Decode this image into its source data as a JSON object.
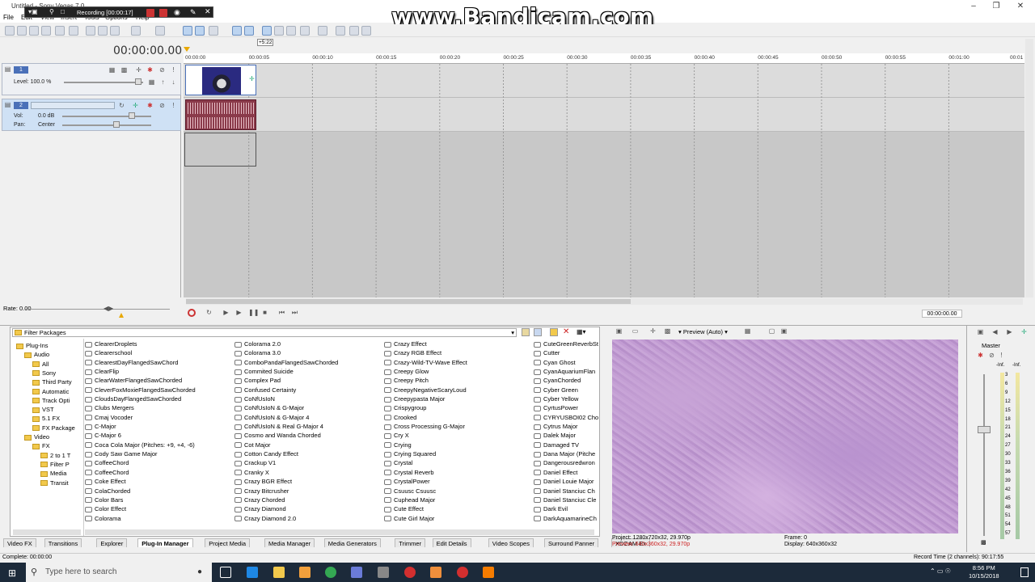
{
  "window": {
    "title": "Untitled - Sony Vegas 7.0"
  },
  "menu": [
    "File",
    "Edit",
    "View",
    "Insert",
    "Tools",
    "Options",
    "Help"
  ],
  "recorder": {
    "label": "Recording [00:00:17]"
  },
  "watermark": "www.Bandicam.com",
  "timecode": "00:00:00.00",
  "cursor_label": "+5:22",
  "ruler_marks": [
    "00:00:00",
    "00:00:05",
    "00:00:10",
    "00:00:15",
    "00:00:20",
    "00:00:25",
    "00:00:30",
    "00:00:35",
    "00:00:40",
    "00:00:45",
    "00:00:50",
    "00:00:55",
    "00:01:00",
    "00:01"
  ],
  "track1": {
    "number": "1",
    "level_label": "Level: 100.0 %"
  },
  "track2": {
    "number": "2",
    "vol_label": "Vol:",
    "vol_value": "0.0 dB",
    "pan_label": "Pan:",
    "pan_value": "Center"
  },
  "rate": "Rate: 0.00",
  "transport_time": "00:00:00.00",
  "plugin_manager": {
    "filter": "Filter Packages",
    "tree": [
      "Plug-Ins",
      "Audio",
      "All",
      "Sony",
      "Third Party",
      "Automatic",
      "Track Opti",
      "VST",
      "5.1 FX",
      "FX Package",
      "Video",
      "FX",
      "2 to 1 T",
      "Filter P",
      "Media",
      "Transit"
    ],
    "col1": [
      "ClearerDroplets",
      "Clearerschool",
      "ClearestDayFlangedSawChord",
      "ClearFlip",
      "ClearWaterFlangedSawChorded",
      "CleverFoxMoxieFlangedSawChorded",
      "CloudsDayFlangedSawChorded",
      "Clubs Mergers",
      "Cmaj Vocoder",
      "C-Major",
      "C-Major 6",
      "Coca Cola Major (Pitches: +9, +4, -6)",
      "Cody Saw Game Major",
      "CoffeeChord",
      "CoffeeChord",
      "Coke Effect",
      "ColaChorded",
      "Color Bars",
      "Color Effect",
      "Colorama"
    ],
    "col2": [
      "Colorama 2.0",
      "Colorama 3.0",
      "ComboPandaFlangedSawChorded",
      "Commited Suicide",
      "Complex Pad",
      "Confused Certainty",
      "CoNfUsIoN",
      "CoNfUsIoN & G-Major",
      "CoNfUsIoN & G-Major 4",
      "CoNfUsIoN & Real G-Major 4",
      "Cosmo and Wanda Chorded",
      "Cot Major",
      "Cotton Candy Effect",
      "Crackup V1",
      "Cranky X",
      "Crazy BGR Effect",
      "Crazy Bitcrusher",
      "Crazy Chorded",
      "Crazy Diamond",
      "Crazy Diamond 2.0"
    ],
    "col3": [
      "Crazy Effect",
      "Crazy RGB Effect",
      "Crazy-Wild-TV-Wave Effect",
      "Creepy Glow",
      "Creepy Pitch",
      "CreepyNegativeScaryLoud",
      "Creepypasta Major",
      "Crispygroup",
      "Crooked",
      "Cross Processing G-Major",
      "Cry X",
      "Crying",
      "Crying Squared",
      "Crystal",
      "Crystal Reverb",
      "CrystalPower",
      "Csuusc Csuusc",
      "Cuphead Major",
      "Cute Effect",
      "Cute Girl Major"
    ],
    "col4": [
      "CuteGreenReverbSt",
      "Cutter",
      "Cyan Ghost",
      "CyanAquariumFlan",
      "CyanChorded",
      "Cyber Green",
      "Cyber Yellow",
      "CyrtusPower",
      "CYRYUSBOI02 Chor",
      "Cytrus Major",
      "Dalek Major",
      "Damaged TV",
      "Dana Major (Pitche",
      "Dangerousredwron",
      "Daniel Effect",
      "Daniel Louie Major",
      "Daniel Stanciuc Ch",
      "Daniel Stanciuc Cle",
      "Dark Evil",
      "DarkAquamarineCh"
    ]
  },
  "tabs": [
    "Video FX",
    "Transitions",
    "Explorer",
    "Plug-In Manager",
    "Project Media",
    "Media Manager",
    "Media Generators",
    "Trimmer",
    "Edit Details",
    "Video Scopes",
    "Surround Panner",
    "XDCAM Ex"
  ],
  "preview": {
    "mode": "Preview (Auto)",
    "project": "Project:  1280x720x32, 29.970p",
    "preview": "Preview:  640x360x32, 29.970p",
    "frame": "Frame:    0",
    "display": "Display:   640x360x32"
  },
  "master": {
    "label": "Master",
    "inf1": "-Inf.",
    "inf2": "-Inf.",
    "scale": [
      "3",
      "6",
      "9",
      "12",
      "15",
      "18",
      "21",
      "24",
      "27",
      "30",
      "33",
      "36",
      "39",
      "42",
      "45",
      "48",
      "51",
      "54",
      "57"
    ]
  },
  "status": {
    "left": "Complete: 00:00:00",
    "right": "Record Time (2 channels): 90:17:55"
  },
  "taskbar": {
    "search": "Type here to search",
    "time": "8:56 PM",
    "date": "10/15/2018"
  }
}
